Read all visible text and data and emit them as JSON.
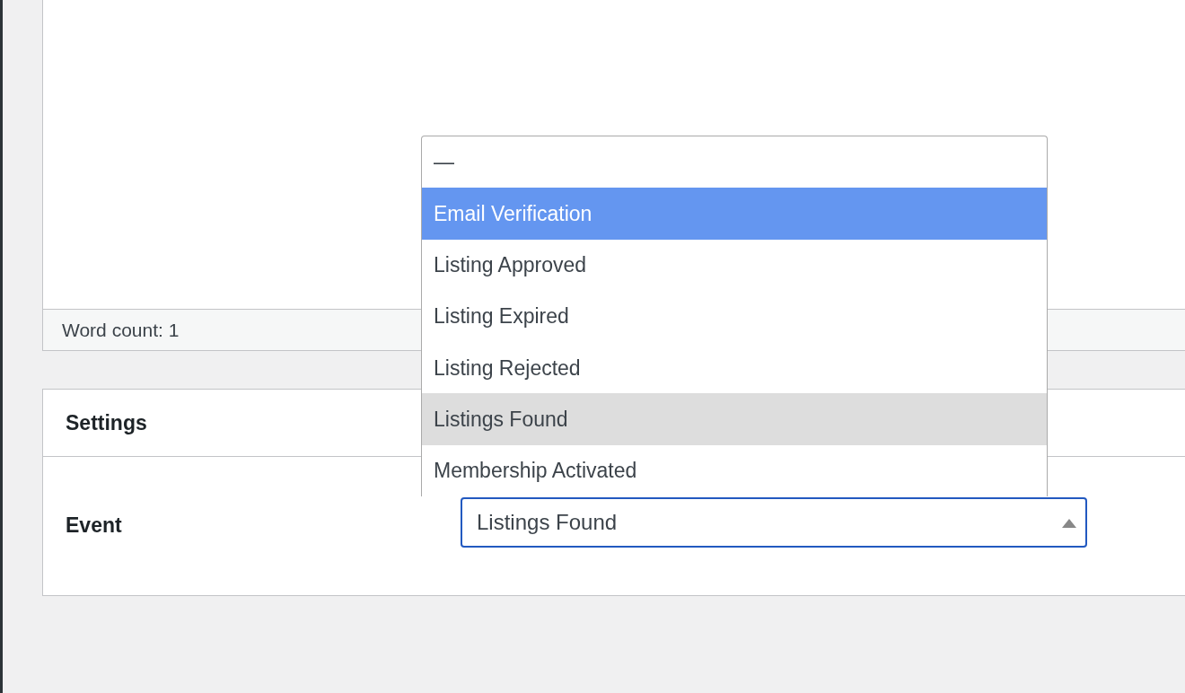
{
  "editor": {
    "word_count": "Word count: 1"
  },
  "settings": {
    "title": "Settings",
    "field_label": "Event",
    "select": {
      "value": "Listings Found",
      "expanded": true,
      "options": [
        {
          "label": "—",
          "selected": false,
          "highlighted": false
        },
        {
          "label": "Email Verification",
          "selected": false,
          "highlighted": true
        },
        {
          "label": "Listing Approved",
          "selected": false,
          "highlighted": false
        },
        {
          "label": "Listing Expired",
          "selected": false,
          "highlighted": false
        },
        {
          "label": "Listing Rejected",
          "selected": false,
          "highlighted": false
        },
        {
          "label": "Listings Found",
          "selected": true,
          "highlighted": false
        },
        {
          "label": "Membership Activated",
          "selected": false,
          "highlighted": false
        }
      ]
    }
  }
}
